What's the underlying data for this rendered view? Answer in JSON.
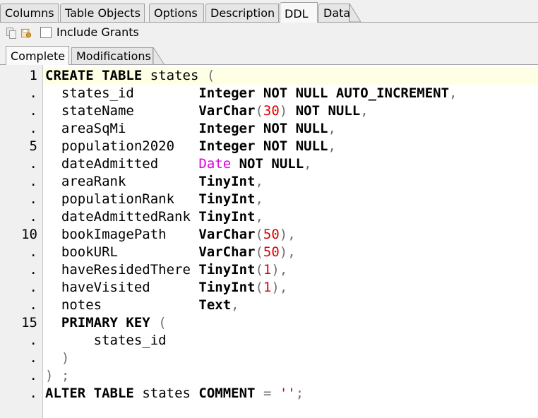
{
  "tabs": [
    "Columns",
    "Table Objects",
    "Options",
    "Description",
    "DDL",
    "Data"
  ],
  "active_tab": "DDL",
  "toolbar": {
    "icons": [
      "copy-icon",
      "save-icon"
    ],
    "include_grants_label": "Include Grants",
    "include_grants_checked": false
  },
  "subtabs": [
    "Complete",
    "Modifications"
  ],
  "active_subtab": "Complete",
  "editor": {
    "line_markers": [
      "1",
      ".",
      ".",
      ".",
      "5",
      ".",
      ".",
      ".",
      ".",
      "10",
      ".",
      ".",
      ".",
      ".",
      "15",
      ".",
      ".",
      ".",
      "."
    ],
    "lines": [
      "CREATE TABLE states (",
      "  states_id        Integer NOT NULL AUTO_INCREMENT,",
      "  stateName        VarChar(30) NOT NULL,",
      "  areaSqMi         Integer NOT NULL,",
      "  population2020   Integer NOT NULL,",
      "  dateAdmitted     Date NOT NULL,",
      "  areaRank         TinyInt,",
      "  populationRank   TinyInt,",
      "  dateAdmittedRank TinyInt,",
      "  bookImagePath    VarChar(50),",
      "  bookURL          VarChar(50),",
      "  haveResidedThere TinyInt(1),",
      "  haveVisited      TinyInt(1),",
      "  notes            Text,",
      "  PRIMARY KEY (",
      "      states_id",
      "  )",
      ") ;",
      "ALTER TABLE states COMMENT = '';"
    ]
  }
}
